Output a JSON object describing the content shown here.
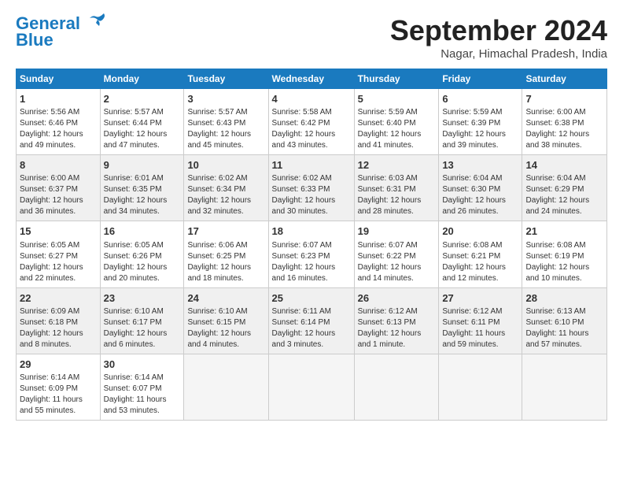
{
  "logo": {
    "line1": "General",
    "line2": "Blue"
  },
  "title": "September 2024",
  "location": "Nagar, Himachal Pradesh, India",
  "days_of_week": [
    "Sunday",
    "Monday",
    "Tuesday",
    "Wednesday",
    "Thursday",
    "Friday",
    "Saturday"
  ],
  "weeks": [
    [
      {
        "day": 1,
        "sunrise": "5:56 AM",
        "sunset": "6:46 PM",
        "daylight": "12 hours and 49 minutes."
      },
      {
        "day": 2,
        "sunrise": "5:57 AM",
        "sunset": "6:44 PM",
        "daylight": "12 hours and 47 minutes."
      },
      {
        "day": 3,
        "sunrise": "5:57 AM",
        "sunset": "6:43 PM",
        "daylight": "12 hours and 45 minutes."
      },
      {
        "day": 4,
        "sunrise": "5:58 AM",
        "sunset": "6:42 PM",
        "daylight": "12 hours and 43 minutes."
      },
      {
        "day": 5,
        "sunrise": "5:59 AM",
        "sunset": "6:40 PM",
        "daylight": "12 hours and 41 minutes."
      },
      {
        "day": 6,
        "sunrise": "5:59 AM",
        "sunset": "6:39 PM",
        "daylight": "12 hours and 39 minutes."
      },
      {
        "day": 7,
        "sunrise": "6:00 AM",
        "sunset": "6:38 PM",
        "daylight": "12 hours and 38 minutes."
      }
    ],
    [
      {
        "day": 8,
        "sunrise": "6:00 AM",
        "sunset": "6:37 PM",
        "daylight": "12 hours and 36 minutes."
      },
      {
        "day": 9,
        "sunrise": "6:01 AM",
        "sunset": "6:35 PM",
        "daylight": "12 hours and 34 minutes."
      },
      {
        "day": 10,
        "sunrise": "6:02 AM",
        "sunset": "6:34 PM",
        "daylight": "12 hours and 32 minutes."
      },
      {
        "day": 11,
        "sunrise": "6:02 AM",
        "sunset": "6:33 PM",
        "daylight": "12 hours and 30 minutes."
      },
      {
        "day": 12,
        "sunrise": "6:03 AM",
        "sunset": "6:31 PM",
        "daylight": "12 hours and 28 minutes."
      },
      {
        "day": 13,
        "sunrise": "6:04 AM",
        "sunset": "6:30 PM",
        "daylight": "12 hours and 26 minutes."
      },
      {
        "day": 14,
        "sunrise": "6:04 AM",
        "sunset": "6:29 PM",
        "daylight": "12 hours and 24 minutes."
      }
    ],
    [
      {
        "day": 15,
        "sunrise": "6:05 AM",
        "sunset": "6:27 PM",
        "daylight": "12 hours and 22 minutes."
      },
      {
        "day": 16,
        "sunrise": "6:05 AM",
        "sunset": "6:26 PM",
        "daylight": "12 hours and 20 minutes."
      },
      {
        "day": 17,
        "sunrise": "6:06 AM",
        "sunset": "6:25 PM",
        "daylight": "12 hours and 18 minutes."
      },
      {
        "day": 18,
        "sunrise": "6:07 AM",
        "sunset": "6:23 PM",
        "daylight": "12 hours and 16 minutes."
      },
      {
        "day": 19,
        "sunrise": "6:07 AM",
        "sunset": "6:22 PM",
        "daylight": "12 hours and 14 minutes."
      },
      {
        "day": 20,
        "sunrise": "6:08 AM",
        "sunset": "6:21 PM",
        "daylight": "12 hours and 12 minutes."
      },
      {
        "day": 21,
        "sunrise": "6:08 AM",
        "sunset": "6:19 PM",
        "daylight": "12 hours and 10 minutes."
      }
    ],
    [
      {
        "day": 22,
        "sunrise": "6:09 AM",
        "sunset": "6:18 PM",
        "daylight": "12 hours and 8 minutes."
      },
      {
        "day": 23,
        "sunrise": "6:10 AM",
        "sunset": "6:17 PM",
        "daylight": "12 hours and 6 minutes."
      },
      {
        "day": 24,
        "sunrise": "6:10 AM",
        "sunset": "6:15 PM",
        "daylight": "12 hours and 4 minutes."
      },
      {
        "day": 25,
        "sunrise": "6:11 AM",
        "sunset": "6:14 PM",
        "daylight": "12 hours and 3 minutes."
      },
      {
        "day": 26,
        "sunrise": "6:12 AM",
        "sunset": "6:13 PM",
        "daylight": "12 hours and 1 minute."
      },
      {
        "day": 27,
        "sunrise": "6:12 AM",
        "sunset": "6:11 PM",
        "daylight": "11 hours and 59 minutes."
      },
      {
        "day": 28,
        "sunrise": "6:13 AM",
        "sunset": "6:10 PM",
        "daylight": "11 hours and 57 minutes."
      }
    ],
    [
      {
        "day": 29,
        "sunrise": "6:14 AM",
        "sunset": "6:09 PM",
        "daylight": "11 hours and 55 minutes."
      },
      {
        "day": 30,
        "sunrise": "6:14 AM",
        "sunset": "6:07 PM",
        "daylight": "11 hours and 53 minutes."
      },
      null,
      null,
      null,
      null,
      null
    ]
  ]
}
